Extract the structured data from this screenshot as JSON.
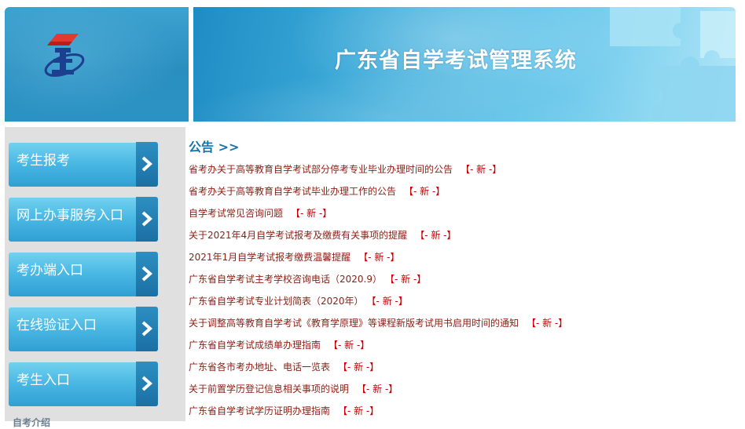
{
  "header": {
    "title": "广东省自学考试管理系统",
    "brand_color": "#2a8fc0"
  },
  "sidebar": {
    "items": [
      {
        "label": "考生报考",
        "icon": "chevron-right-icon"
      },
      {
        "label": "网上办事服务入口",
        "icon": "chevron-right-icon"
      },
      {
        "label": "考办端入口",
        "icon": "chevron-right-icon"
      },
      {
        "label": "在线验证入口",
        "icon": "chevron-right-icon"
      },
      {
        "label": "考生入口",
        "icon": "chevron-right-icon"
      }
    ],
    "more_label": "自考介绍"
  },
  "announcements": {
    "title": "公告 >>",
    "new_tag": "【- 新 -】",
    "items": [
      "省考办关于高等教育自学考试部分停考专业毕业办理时间的公告",
      "省考办关于高等教育自学考试毕业办理工作的公告",
      "自学考试常见咨询问题",
      "关于2021年4月自学考试报考及缴费有关事项的提醒",
      "2021年1月自学考试报考缴费温馨提醒",
      "广东省自学考试主考学校咨询电话（2020.9）",
      "广东省自学考试专业计划简表（2020年）",
      "关于调整高等教育自学考试《教育学原理》等课程新版考试用书启用时间的通知",
      "广东省自学考试成绩单办理指南",
      "广东省各市考办地址、电话一览表",
      "关于前置学历登记信息相关事项的说明",
      "广东省自学考试学历证明办理指南"
    ]
  }
}
